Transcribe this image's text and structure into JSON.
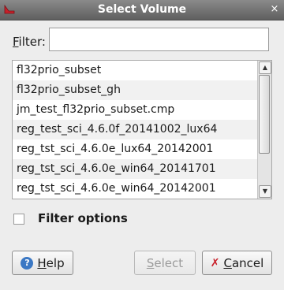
{
  "window": {
    "title": "Select Volume",
    "close_glyph": "×",
    "icon_color": "#c8202a"
  },
  "filter": {
    "label_mnemonic": "F",
    "label_rest": "ilter:",
    "value": "",
    "placeholder": ""
  },
  "volumes": {
    "items": [
      "fl32prio_subset",
      "fl32prio_subset_gh",
      "jm_test_fl32prio_subset.cmp",
      "reg_test_sci_4.6.0f_20141002_lux64",
      "reg_tst_sci_4.6.0e_lux64_20142001",
      "reg_tst_sci_4.6.0e_win64_20141701",
      "reg_tst_sci_4.6.0e_win64_20142001"
    ],
    "scroll_up_glyph": "▲",
    "scroll_down_glyph": "▼"
  },
  "options": {
    "filter_options_label": "Filter options",
    "checked": false
  },
  "buttons": {
    "help_mnemonic": "H",
    "help_rest": "elp",
    "help_icon_glyph": "?",
    "select_mnemonic": "S",
    "select_rest": "elect",
    "select_enabled": false,
    "cancel_mnemonic": "C",
    "cancel_rest": "ancel",
    "cancel_icon_glyph": "✗"
  }
}
